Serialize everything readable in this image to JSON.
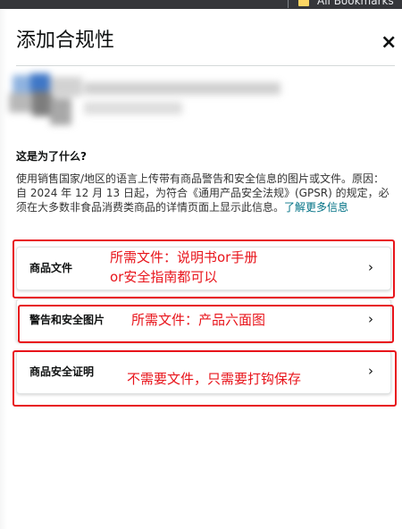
{
  "browser": {
    "bookmarks_label": "All Bookmarks"
  },
  "dialog": {
    "title": "添加合规性",
    "close_label": "×",
    "question": "这是为了什么?",
    "description": "使用销售国家/地区的语言上传带有商品警告和安全信息的图片或文件。原因：自 2024 年 12 月 13 日起，为符合《通用产品安全法规》(GPSR) 的规定，必须在大多数非食品消费类商品的详情页面上显示此信息。",
    "learn_more": "了解更多信息",
    "cards": [
      {
        "label": "商品文件",
        "chevron": "›"
      },
      {
        "label": "警告和安全图片",
        "chevron": "›"
      },
      {
        "label": "商品安全证明",
        "chevron": "›"
      }
    ]
  },
  "annotations": {
    "note1_line1": "所需文件：说明书or手册",
    "note1_line2": "or安全指南都可以",
    "note2": "所需文件：产品六面图",
    "note3": "不需要文件，只需要打钩保存",
    "color": "#e8141b"
  },
  "colors": {
    "link": "#007185",
    "text": "#0f1111",
    "annotation_red": "#e8141b"
  }
}
